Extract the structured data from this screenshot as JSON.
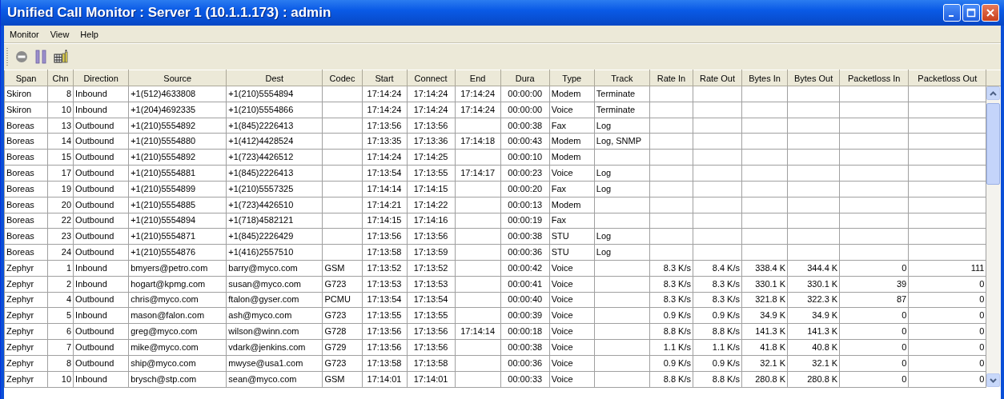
{
  "window": {
    "title": "Unified Call Monitor : Server 1 (10.1.1.173) : admin"
  },
  "menu": [
    "Monitor",
    "View",
    "Help"
  ],
  "table": {
    "columns": [
      "Span",
      "Chn",
      "Direction",
      "Source",
      "Dest",
      "Codec",
      "Start",
      "Connect",
      "End",
      "Dura",
      "Type",
      "Track",
      "Rate In",
      "Rate Out",
      "Bytes In",
      "Bytes Out",
      "Packetloss In",
      "Packetloss Out"
    ],
    "rows": [
      [
        "Skiron",
        "8",
        "Inbound",
        "+1(512)4633808",
        "+1(210)5554894",
        null,
        "17:14:24",
        "17:14:24",
        "17:14:24",
        "00:00:00",
        "Modem",
        "Terminate",
        null,
        null,
        null,
        null,
        null,
        null
      ],
      [
        "Skiron",
        "10",
        "Inbound",
        "+1(204)4692335",
        "+1(210)5554866",
        null,
        "17:14:24",
        "17:14:24",
        "17:14:24",
        "00:00:00",
        "Voice",
        "Terminate",
        null,
        null,
        null,
        null,
        null,
        null
      ],
      [
        "Boreas",
        "13",
        "Outbound",
        "+1(210)5554892",
        "+1(845)2226413",
        null,
        "17:13:56",
        "17:13:56",
        null,
        "00:00:38",
        "Fax",
        "Log",
        null,
        null,
        null,
        null,
        null,
        null
      ],
      [
        "Boreas",
        "14",
        "Outbound",
        "+1(210)5554880",
        "+1(412)4428524",
        null,
        "17:13:35",
        "17:13:36",
        "17:14:18",
        "00:00:43",
        "Modem",
        "Log, SNMP",
        null,
        null,
        null,
        null,
        null,
        null
      ],
      [
        "Boreas",
        "15",
        "Outbound",
        "+1(210)5554892",
        "+1(723)4426512",
        null,
        "17:14:24",
        "17:14:25",
        null,
        "00:00:10",
        "Modem",
        null,
        null,
        null,
        null,
        null,
        null,
        null
      ],
      [
        "Boreas",
        "17",
        "Outbound",
        "+1(210)5554881",
        "+1(845)2226413",
        null,
        "17:13:54",
        "17:13:55",
        "17:14:17",
        "00:00:23",
        "Voice",
        "Log",
        null,
        null,
        null,
        null,
        null,
        null
      ],
      [
        "Boreas",
        "19",
        "Outbound",
        "+1(210)5554899",
        "+1(210)5557325",
        null,
        "17:14:14",
        "17:14:15",
        null,
        "00:00:20",
        "Fax",
        "Log",
        null,
        null,
        null,
        null,
        null,
        null
      ],
      [
        "Boreas",
        "20",
        "Outbound",
        "+1(210)5554885",
        "+1(723)4426510",
        null,
        "17:14:21",
        "17:14:22",
        null,
        "00:00:13",
        "Modem",
        null,
        null,
        null,
        null,
        null,
        null,
        null
      ],
      [
        "Boreas",
        "22",
        "Outbound",
        "+1(210)5554894",
        "+1(718)4582121",
        null,
        "17:14:15",
        "17:14:16",
        null,
        "00:00:19",
        "Fax",
        null,
        null,
        null,
        null,
        null,
        null,
        null
      ],
      [
        "Boreas",
        "23",
        "Outbound",
        "+1(210)5554871",
        "+1(845)2226429",
        null,
        "17:13:56",
        "17:13:56",
        null,
        "00:00:38",
        "STU",
        "Log",
        null,
        null,
        null,
        null,
        null,
        null
      ],
      [
        "Boreas",
        "24",
        "Outbound",
        "+1(210)5554876",
        "+1(416)2557510",
        null,
        "17:13:58",
        "17:13:59",
        null,
        "00:00:36",
        "STU",
        "Log",
        null,
        null,
        null,
        null,
        null,
        null
      ],
      [
        "Zephyr",
        "1",
        "Inbound",
        "bmyers@petro.com",
        "barry@myco.com",
        "GSM",
        "17:13:52",
        "17:13:52",
        null,
        "00:00:42",
        "Voice",
        null,
        "8.3 K/s",
        "8.4 K/s",
        "338.4 K",
        "344.4 K",
        "0",
        "111"
      ],
      [
        "Zephyr",
        "2",
        "Inbound",
        "hogart@kpmg.com",
        "susan@myco.com",
        "G723",
        "17:13:53",
        "17:13:53",
        null,
        "00:00:41",
        "Voice",
        null,
        "8.3 K/s",
        "8.3 K/s",
        "330.1 K",
        "330.1 K",
        "39",
        "0"
      ],
      [
        "Zephyr",
        "4",
        "Outbound",
        "chris@myco.com",
        "ftalon@gyser.com",
        "PCMU",
        "17:13:54",
        "17:13:54",
        null,
        "00:00:40",
        "Voice",
        null,
        "8.3 K/s",
        "8.3 K/s",
        "321.8 K",
        "322.3 K",
        "87",
        "0"
      ],
      [
        "Zephyr",
        "5",
        "Inbound",
        "mason@falon.com",
        "ash@myco.com",
        "G723",
        "17:13:55",
        "17:13:55",
        null,
        "00:00:39",
        "Voice",
        null,
        "0.9 K/s",
        "0.9 K/s",
        "34.9 K",
        "34.9 K",
        "0",
        "0"
      ],
      [
        "Zephyr",
        "6",
        "Outbound",
        "greg@myco.com",
        "wilson@winn.com",
        "G728",
        "17:13:56",
        "17:13:56",
        "17:14:14",
        "00:00:18",
        "Voice",
        null,
        "8.8 K/s",
        "8.8 K/s",
        "141.3 K",
        "141.3 K",
        "0",
        "0"
      ],
      [
        "Zephyr",
        "7",
        "Outbound",
        "mike@myco.com",
        "vdark@jenkins.com",
        "G729",
        "17:13:56",
        "17:13:56",
        null,
        "00:00:38",
        "Voice",
        null,
        "1.1 K/s",
        "1.1 K/s",
        "41.8 K",
        "40.8 K",
        "0",
        "0"
      ],
      [
        "Zephyr",
        "8",
        "Outbound",
        "ship@myco.com",
        "mwyse@usa1.com",
        "G723",
        "17:13:58",
        "17:13:58",
        null,
        "00:00:36",
        "Voice",
        null,
        "0.9 K/s",
        "0.9 K/s",
        "32.1 K",
        "32.1 K",
        "0",
        "0"
      ],
      [
        "Zephyr",
        "10",
        "Inbound",
        "brysch@stp.com",
        "sean@myco.com",
        "GSM",
        "17:14:01",
        "17:14:01",
        null,
        "00:00:33",
        "Voice",
        null,
        "8.8 K/s",
        "8.8 K/s",
        "280.8 K",
        "280.8 K",
        "0",
        "0"
      ]
    ]
  }
}
